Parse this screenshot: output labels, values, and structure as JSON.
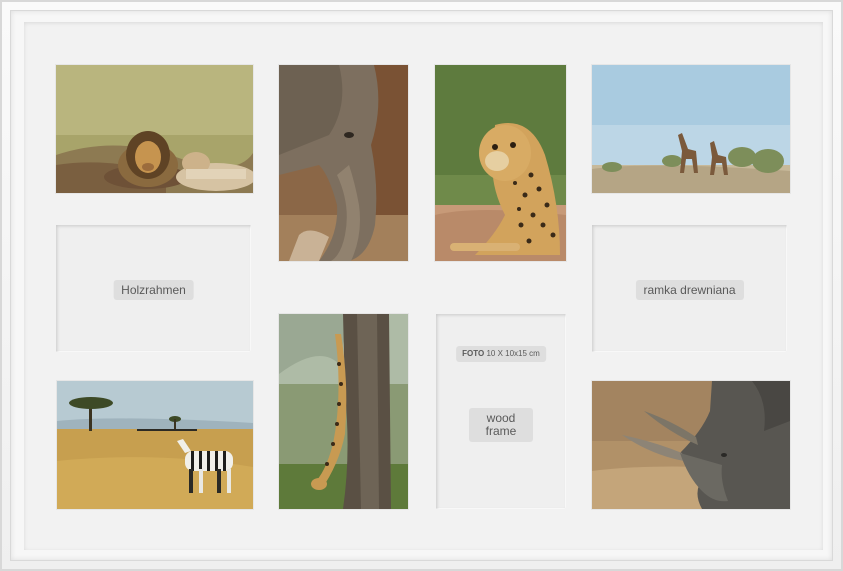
{
  "labels": {
    "holzrahmen": "Holzrahmen",
    "ramka": "ramka drewniana",
    "foto_prefix": "FOTO",
    "foto_size": "10 X 10x15 cm",
    "wood_frame_line1": "wood",
    "wood_frame_line2": "frame"
  },
  "photos": [
    {
      "subject": "lion-pair"
    },
    {
      "subject": "elephant"
    },
    {
      "subject": "cheetah"
    },
    {
      "subject": "giraffes"
    },
    {
      "subject": "zebra-savanna"
    },
    {
      "subject": "leopard-tree"
    },
    {
      "subject": "rhino"
    }
  ],
  "colors": {
    "frame": "#f5f5f5",
    "mat": "#f2f2f2",
    "label_bg": "#dedede",
    "label_text": "#5a5a5a"
  }
}
